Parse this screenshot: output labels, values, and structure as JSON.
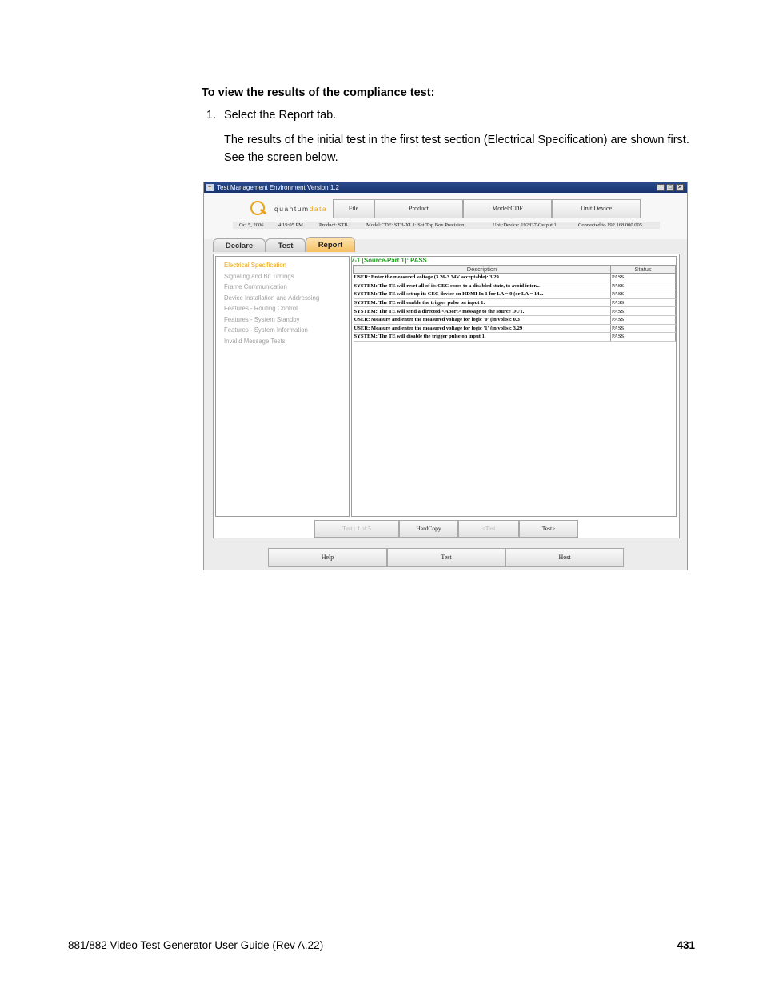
{
  "doc": {
    "heading": "To view the results of the compliance test:",
    "step_number": "1.",
    "step_text": "Select the Report tab.",
    "paragraph": "The results of the initial test in the first test section (Electrical Specification) are shown first. See the screen below.",
    "footer_left": "881/882 Video Test Generator User Guide (Rev A.22)",
    "footer_page": "431"
  },
  "app": {
    "title": "Test Management Environment Version 1.2",
    "window_buttons": {
      "minimize": "_",
      "maximize": "□",
      "close": "✕"
    },
    "logo": {
      "text_main": "quantum",
      "text_accent": "data",
      "icon": "quantumdata-logo-icon",
      "accent_color": "#e8a317"
    },
    "menu": [
      "File",
      "Product",
      "Model:CDF",
      "Unit:Device"
    ],
    "info": {
      "date": "Oct 5, 2006",
      "time": "4:19:05 PM",
      "product": "Product: STB",
      "model": "Model:CDF: STB-XL1: Set Top Box Precision",
      "unit": "Unit:Device: 192837-Output 1",
      "connected": "Connected to 192.168.000.005"
    },
    "tabs": [
      {
        "label": "Declare",
        "active": false
      },
      {
        "label": "Test",
        "active": false
      },
      {
        "label": "Report",
        "active": true
      }
    ],
    "sections": [
      "Electrical Specification",
      "Signaling and Bit Timings",
      "Frame Communication",
      "Device Installation and Addressing",
      "Features - Routing Control",
      "Features - System Standby",
      "Features - System Information",
      "Invalid Message Tests"
    ],
    "active_section_color": "#e8a317",
    "result_title": "7-1 [Source-Part 1]: PASS",
    "pass_color": "#1aa01a",
    "table": {
      "headers": [
        "Description",
        "Status"
      ],
      "rows": [
        [
          "USER: Enter the measured voltage (3.26-3.34V acceptable): 3.29",
          "PASS"
        ],
        [
          "SYSTEM: The TE will reset all of its CEC cores to a disabled state, to avoid inter...",
          "PASS"
        ],
        [
          "SYSTEM: The TE will set up its CEC device on HDMI In 1 for LA = 0 (or LA = 14...",
          "PASS"
        ],
        [
          "SYSTEM: The TE will enable the trigger pulse on input 1.",
          "PASS"
        ],
        [
          "SYSTEM: The TE will send a directed <Abort> message to the source DUT.",
          "PASS"
        ],
        [
          "USER: Measure and enter the measured voltage for logic '0' (in volts): 0.3",
          "PASS"
        ],
        [
          "USER: Measure and enter the measured voltage for logic '1' (in volts): 3.29",
          "PASS"
        ],
        [
          "SYSTEM: The TE will disable the trigger pulse on input 1.",
          "PASS"
        ]
      ]
    },
    "nav": {
      "test_counter": "Test : 1 of 5",
      "hardcopy": "HardCopy",
      "prev": "<Test",
      "next": "Test>"
    },
    "bottom": [
      "Help",
      "Test",
      "Host"
    ]
  }
}
